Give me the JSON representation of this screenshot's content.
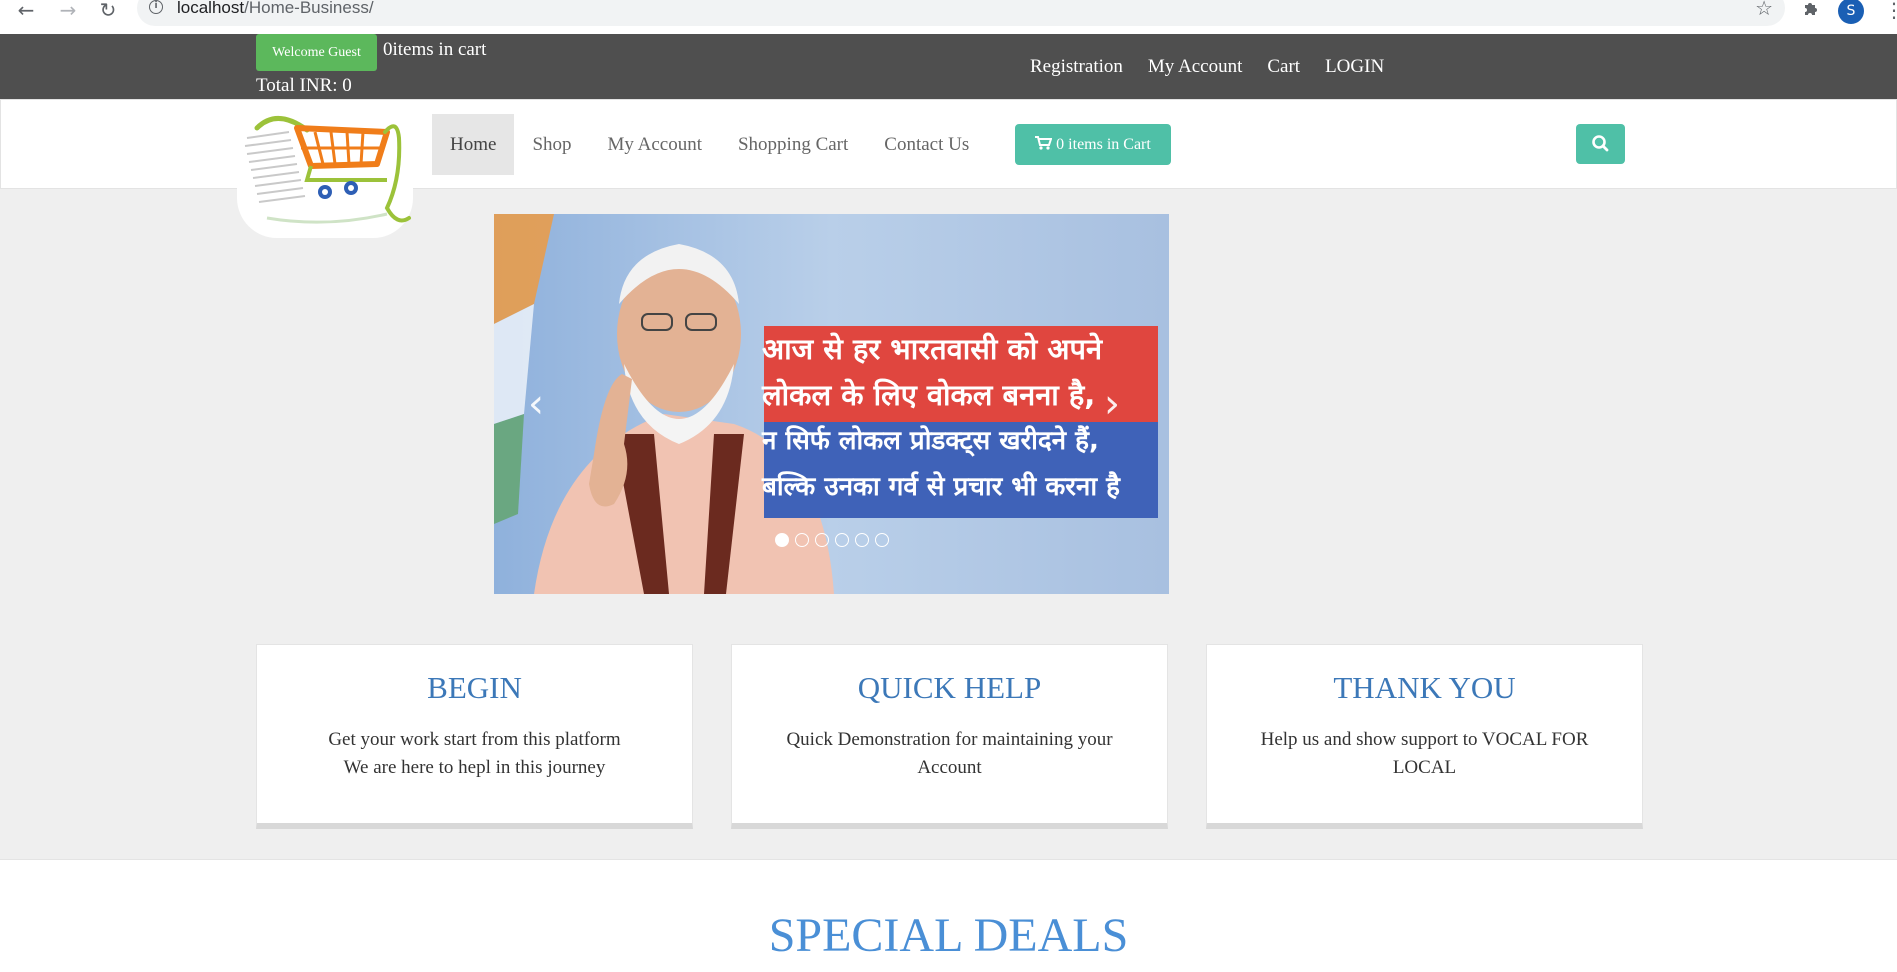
{
  "browser": {
    "url_host": "localhost",
    "url_path": "/Home-Business/",
    "profile_initial": "S"
  },
  "topbar": {
    "welcome_label": "Welcome Guest",
    "cart_count": "0items in cart",
    "total": "Total INR: 0",
    "links": [
      "Registration",
      "My Account",
      "Cart",
      "LOGIN"
    ]
  },
  "nav": {
    "items": [
      "Home",
      "Shop",
      "My Account",
      "Shopping Cart",
      "Contact Us"
    ],
    "active": "Home",
    "cart_button": "0 items in Cart"
  },
  "carousel": {
    "banner_lines": [
      "आज से हर भारतवासी को अपने",
      "लोकल के लिए वोकल बनना है,",
      "न सिर्फ लोकल प्रोडक्ट्स खरीदने हैं,",
      "बल्कि उनका गर्व से प्रचार भी करना है"
    ],
    "slide_count": 6,
    "active_slide": 1
  },
  "features": [
    {
      "title": "BEGIN",
      "text_line1": "Get your work start from this platform",
      "text_line2": "We are here to hepl in this journey"
    },
    {
      "title": "QUICK HELP",
      "text_line1": "Quick Demonstration for maintaining your Account",
      "text_line2": ""
    },
    {
      "title": "THANK YOU",
      "text_line1": "Help us and show support to VOCAL FOR LOCAL",
      "text_line2": ""
    }
  ],
  "deals": {
    "heading": "SPECIAL DEALS"
  },
  "colors": {
    "topbar": "#4f4f4f",
    "welcome_green": "#5cb85c",
    "accent_teal": "#4fc0a7",
    "heading_blue": "#3c78b8",
    "deals_blue": "#4a8fd6",
    "banner_red": "#e0463f",
    "banner_blue": "#3f62b8"
  }
}
